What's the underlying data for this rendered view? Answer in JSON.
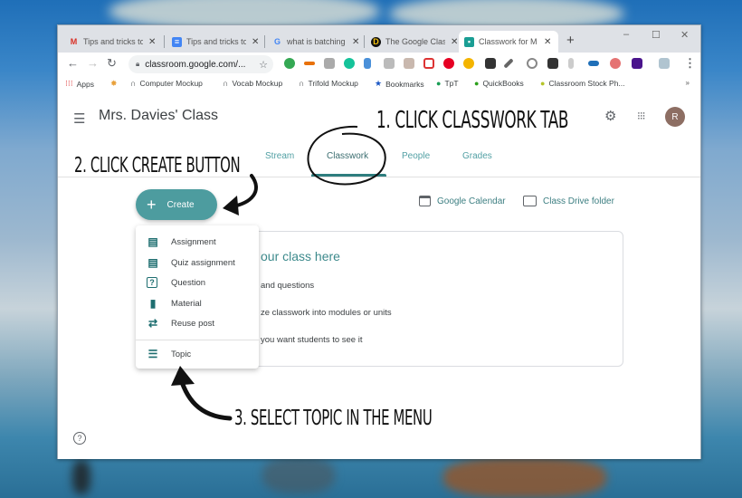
{
  "browser": {
    "tabs": [
      {
        "label": "Tips and tricks to",
        "favicon": "gmail-icon",
        "active": false
      },
      {
        "label": "Tips and tricks to",
        "favicon": "docs-icon",
        "active": false
      },
      {
        "label": "what is batching",
        "favicon": "google-icon",
        "active": false
      },
      {
        "label": "The Google Clas",
        "favicon": "d-icon",
        "active": false
      },
      {
        "label": "Classwork for M",
        "favicon": "classroom-icon",
        "active": true
      }
    ],
    "new_tab": "+",
    "window_controls": {
      "minimize": "–",
      "maximize": "☐",
      "close": "✕"
    },
    "url": "classroom.google.com/...",
    "bookmarks": [
      {
        "label": "Apps",
        "icon": "apps-grid-icon"
      },
      {
        "label": "",
        "icon": "colorful-icon"
      },
      {
        "label": "Computer Mockup",
        "icon": "mockup-icon"
      },
      {
        "label": "Vocab Mockup",
        "icon": "mockup-icon"
      },
      {
        "label": "Trifold Mockup",
        "icon": "mockup-icon"
      },
      {
        "label": "Bookmarks",
        "icon": "star-icon"
      },
      {
        "label": "TpT",
        "icon": "tpt-icon"
      },
      {
        "label": "QuickBooks",
        "icon": "quickbooks-icon"
      },
      {
        "label": "Classroom Stock Ph...",
        "icon": "stock-photo-icon"
      }
    ],
    "bookmarks_more": "»"
  },
  "classroom": {
    "class_title": "Mrs. Davies' Class",
    "avatar_initial": "R",
    "nav_tabs": [
      {
        "label": "Stream",
        "active": false
      },
      {
        "label": "Classwork",
        "active": true
      },
      {
        "label": "People",
        "active": false
      },
      {
        "label": "Grades",
        "active": false
      }
    ],
    "create_label": "Create",
    "quick_links": [
      {
        "label": "Google Calendar",
        "icon": "calendar-icon"
      },
      {
        "label": "Class Drive folder",
        "icon": "folder-icon"
      }
    ],
    "card": {
      "title": "our class here",
      "lines": [
        "and questions",
        "ze classwork into modules or units",
        "you want students to see it"
      ]
    },
    "create_menu": [
      {
        "label": "Assignment",
        "icon": "assignment-icon"
      },
      {
        "label": "Quiz assignment",
        "icon": "quiz-assignment-icon"
      },
      {
        "label": "Question",
        "icon": "question-icon"
      },
      {
        "label": "Material",
        "icon": "material-icon"
      },
      {
        "label": "Reuse post",
        "icon": "reuse-icon"
      },
      {
        "label": "Topic",
        "icon": "topic-icon"
      }
    ],
    "help": "?"
  },
  "annotations": {
    "step1": "1. CLICK CLASSWORK TAB",
    "step2": "2. CLICK CREATE BUTTON",
    "step3": "3. SELECT TOPIC IN THE MENU"
  },
  "colors": {
    "accent": "#4d9c9f",
    "tab_text": "#52a0a4",
    "avatar": "#8d6e63"
  }
}
